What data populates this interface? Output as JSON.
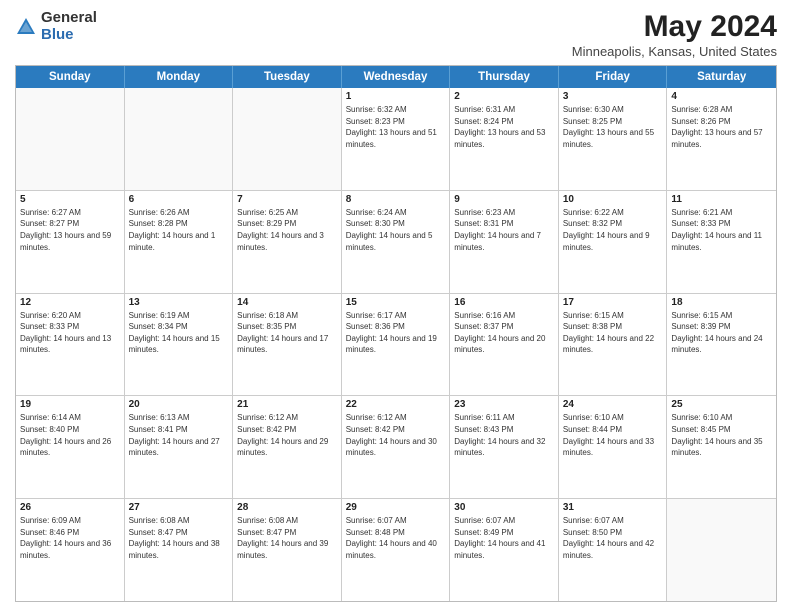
{
  "logo": {
    "general": "General",
    "blue": "Blue"
  },
  "title": {
    "month": "May 2024",
    "location": "Minneapolis, Kansas, United States"
  },
  "header_days": [
    "Sunday",
    "Monday",
    "Tuesday",
    "Wednesday",
    "Thursday",
    "Friday",
    "Saturday"
  ],
  "weeks": [
    [
      {
        "day": "",
        "sunrise": "",
        "sunset": "",
        "daylight": ""
      },
      {
        "day": "",
        "sunrise": "",
        "sunset": "",
        "daylight": ""
      },
      {
        "day": "",
        "sunrise": "",
        "sunset": "",
        "daylight": ""
      },
      {
        "day": "1",
        "sunrise": "Sunrise: 6:32 AM",
        "sunset": "Sunset: 8:23 PM",
        "daylight": "Daylight: 13 hours and 51 minutes."
      },
      {
        "day": "2",
        "sunrise": "Sunrise: 6:31 AM",
        "sunset": "Sunset: 8:24 PM",
        "daylight": "Daylight: 13 hours and 53 minutes."
      },
      {
        "day": "3",
        "sunrise": "Sunrise: 6:30 AM",
        "sunset": "Sunset: 8:25 PM",
        "daylight": "Daylight: 13 hours and 55 minutes."
      },
      {
        "day": "4",
        "sunrise": "Sunrise: 6:28 AM",
        "sunset": "Sunset: 8:26 PM",
        "daylight": "Daylight: 13 hours and 57 minutes."
      }
    ],
    [
      {
        "day": "5",
        "sunrise": "Sunrise: 6:27 AM",
        "sunset": "Sunset: 8:27 PM",
        "daylight": "Daylight: 13 hours and 59 minutes."
      },
      {
        "day": "6",
        "sunrise": "Sunrise: 6:26 AM",
        "sunset": "Sunset: 8:28 PM",
        "daylight": "Daylight: 14 hours and 1 minute."
      },
      {
        "day": "7",
        "sunrise": "Sunrise: 6:25 AM",
        "sunset": "Sunset: 8:29 PM",
        "daylight": "Daylight: 14 hours and 3 minutes."
      },
      {
        "day": "8",
        "sunrise": "Sunrise: 6:24 AM",
        "sunset": "Sunset: 8:30 PM",
        "daylight": "Daylight: 14 hours and 5 minutes."
      },
      {
        "day": "9",
        "sunrise": "Sunrise: 6:23 AM",
        "sunset": "Sunset: 8:31 PM",
        "daylight": "Daylight: 14 hours and 7 minutes."
      },
      {
        "day": "10",
        "sunrise": "Sunrise: 6:22 AM",
        "sunset": "Sunset: 8:32 PM",
        "daylight": "Daylight: 14 hours and 9 minutes."
      },
      {
        "day": "11",
        "sunrise": "Sunrise: 6:21 AM",
        "sunset": "Sunset: 8:33 PM",
        "daylight": "Daylight: 14 hours and 11 minutes."
      }
    ],
    [
      {
        "day": "12",
        "sunrise": "Sunrise: 6:20 AM",
        "sunset": "Sunset: 8:33 PM",
        "daylight": "Daylight: 14 hours and 13 minutes."
      },
      {
        "day": "13",
        "sunrise": "Sunrise: 6:19 AM",
        "sunset": "Sunset: 8:34 PM",
        "daylight": "Daylight: 14 hours and 15 minutes."
      },
      {
        "day": "14",
        "sunrise": "Sunrise: 6:18 AM",
        "sunset": "Sunset: 8:35 PM",
        "daylight": "Daylight: 14 hours and 17 minutes."
      },
      {
        "day": "15",
        "sunrise": "Sunrise: 6:17 AM",
        "sunset": "Sunset: 8:36 PM",
        "daylight": "Daylight: 14 hours and 19 minutes."
      },
      {
        "day": "16",
        "sunrise": "Sunrise: 6:16 AM",
        "sunset": "Sunset: 8:37 PM",
        "daylight": "Daylight: 14 hours and 20 minutes."
      },
      {
        "day": "17",
        "sunrise": "Sunrise: 6:15 AM",
        "sunset": "Sunset: 8:38 PM",
        "daylight": "Daylight: 14 hours and 22 minutes."
      },
      {
        "day": "18",
        "sunrise": "Sunrise: 6:15 AM",
        "sunset": "Sunset: 8:39 PM",
        "daylight": "Daylight: 14 hours and 24 minutes."
      }
    ],
    [
      {
        "day": "19",
        "sunrise": "Sunrise: 6:14 AM",
        "sunset": "Sunset: 8:40 PM",
        "daylight": "Daylight: 14 hours and 26 minutes."
      },
      {
        "day": "20",
        "sunrise": "Sunrise: 6:13 AM",
        "sunset": "Sunset: 8:41 PM",
        "daylight": "Daylight: 14 hours and 27 minutes."
      },
      {
        "day": "21",
        "sunrise": "Sunrise: 6:12 AM",
        "sunset": "Sunset: 8:42 PM",
        "daylight": "Daylight: 14 hours and 29 minutes."
      },
      {
        "day": "22",
        "sunrise": "Sunrise: 6:12 AM",
        "sunset": "Sunset: 8:42 PM",
        "daylight": "Daylight: 14 hours and 30 minutes."
      },
      {
        "day": "23",
        "sunrise": "Sunrise: 6:11 AM",
        "sunset": "Sunset: 8:43 PM",
        "daylight": "Daylight: 14 hours and 32 minutes."
      },
      {
        "day": "24",
        "sunrise": "Sunrise: 6:10 AM",
        "sunset": "Sunset: 8:44 PM",
        "daylight": "Daylight: 14 hours and 33 minutes."
      },
      {
        "day": "25",
        "sunrise": "Sunrise: 6:10 AM",
        "sunset": "Sunset: 8:45 PM",
        "daylight": "Daylight: 14 hours and 35 minutes."
      }
    ],
    [
      {
        "day": "26",
        "sunrise": "Sunrise: 6:09 AM",
        "sunset": "Sunset: 8:46 PM",
        "daylight": "Daylight: 14 hours and 36 minutes."
      },
      {
        "day": "27",
        "sunrise": "Sunrise: 6:08 AM",
        "sunset": "Sunset: 8:47 PM",
        "daylight": "Daylight: 14 hours and 38 minutes."
      },
      {
        "day": "28",
        "sunrise": "Sunrise: 6:08 AM",
        "sunset": "Sunset: 8:47 PM",
        "daylight": "Daylight: 14 hours and 39 minutes."
      },
      {
        "day": "29",
        "sunrise": "Sunrise: 6:07 AM",
        "sunset": "Sunset: 8:48 PM",
        "daylight": "Daylight: 14 hours and 40 minutes."
      },
      {
        "day": "30",
        "sunrise": "Sunrise: 6:07 AM",
        "sunset": "Sunset: 8:49 PM",
        "daylight": "Daylight: 14 hours and 41 minutes."
      },
      {
        "day": "31",
        "sunrise": "Sunrise: 6:07 AM",
        "sunset": "Sunset: 8:50 PM",
        "daylight": "Daylight: 14 hours and 42 minutes."
      },
      {
        "day": "",
        "sunrise": "",
        "sunset": "",
        "daylight": ""
      }
    ]
  ]
}
